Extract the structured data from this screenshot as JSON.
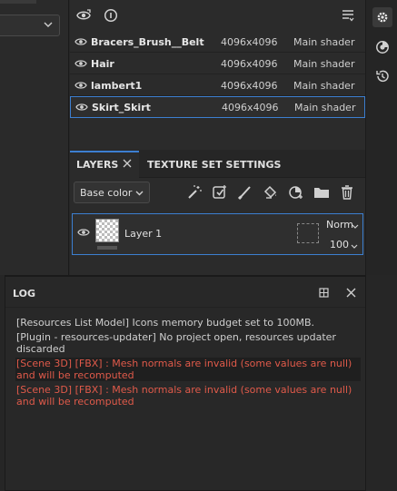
{
  "texture_sets": {
    "rows": [
      {
        "name": "Bracers_Brush__Belt",
        "resolution": "4096x4096",
        "shader": "Main shader",
        "selected": false
      },
      {
        "name": "Hair",
        "resolution": "4096x4096",
        "shader": "Main shader",
        "selected": false
      },
      {
        "name": "lambert1",
        "resolution": "4096x4096",
        "shader": "Main shader",
        "selected": false
      },
      {
        "name": "Skirt_Skirt",
        "resolution": "4096x4096",
        "shader": "Main shader",
        "selected": true
      }
    ]
  },
  "layers": {
    "tabs": [
      {
        "label": "LAYERS",
        "active": true
      },
      {
        "label": "TEXTURE SET SETTINGS",
        "active": false
      }
    ],
    "channel": "Base color",
    "layer": {
      "name": "Layer 1",
      "blend_mode": "Norm",
      "opacity": "100"
    }
  },
  "log": {
    "title": "LOG",
    "lines": [
      {
        "text": "[Resources List Model] Icons memory budget set to 100MB.",
        "level": "info"
      },
      {
        "text": "[Plugin - resources-updater] No project open, resources updater discarded",
        "level": "info"
      },
      {
        "text": "[Scene 3D] [FBX] : Mesh normals are invalid (some values are null) and will be recomputed",
        "level": "error"
      },
      {
        "text": "[Scene 3D] [FBX] : Mesh normals are invalid (some values are null) and will be recomputed",
        "level": "error"
      }
    ]
  },
  "colors": {
    "accent": "#3c7fd1",
    "error": "#e05a4a",
    "panel": "#2b2b2b"
  },
  "icons": {
    "toolbar": [
      "eye-cycle-icon",
      "info-icon",
      "list-filter-icon"
    ],
    "right_bar": [
      "settings-icon",
      "shader-icon",
      "history-icon"
    ],
    "layer_tools": [
      "magic-wand-icon",
      "add-effect-icon",
      "paint-brush-icon",
      "fill-icon",
      "smart-material-icon",
      "folder-icon",
      "trash-icon"
    ]
  }
}
